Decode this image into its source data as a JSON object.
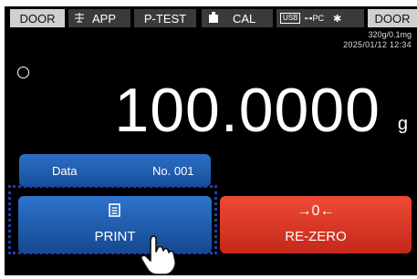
{
  "topbar": {
    "door_left": "DOOR",
    "app": "APP",
    "ptest": "P-TEST",
    "cal": "CAL",
    "usb": "USB",
    "pc": "PC",
    "door_right": "DOOR"
  },
  "info": {
    "capacity": "320g/0.1mg",
    "datetime": "2025/01/12  12:34"
  },
  "display": {
    "weight": "100.0000",
    "unit": "g"
  },
  "data_panel": {
    "label": "Data",
    "number": "No. 001"
  },
  "buttons": {
    "print": "PRINT",
    "rezero_icon": "→0←",
    "rezero": "RE-ZERO"
  },
  "icons": {
    "app": "balance-icon",
    "cal": "weight-icon",
    "print": "document-icon",
    "pointer": "hand-pointer-icon"
  }
}
